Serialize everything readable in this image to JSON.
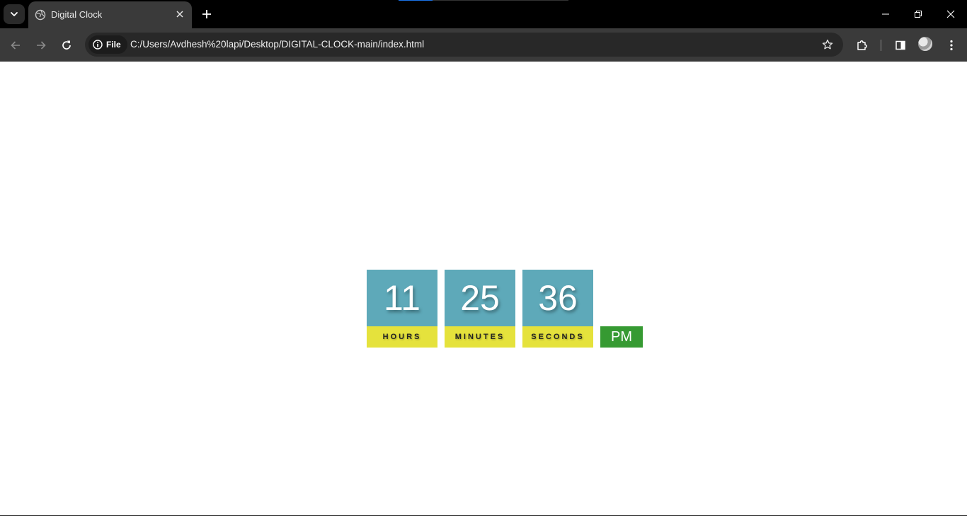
{
  "browser": {
    "tab": {
      "title": "Digital Clock"
    },
    "site_chip_label": "File",
    "url": "C:/Users/Avdhesh%20lapi/Desktop/DIGITAL-CLOCK-main/index.html"
  },
  "icons": {
    "tab_search": "chevron-down-icon",
    "favicon": "globe-icon",
    "tab_close": "close-icon",
    "new_tab": "plus-icon",
    "minimize": "minimize-icon",
    "restore": "restore-icon",
    "close": "close-icon",
    "back": "arrow-left-icon",
    "forward": "arrow-right-icon",
    "reload": "reload-icon",
    "info": "info-icon",
    "bookmark": "star-icon",
    "extensions": "puzzle-icon",
    "side_panel": "side-panel-icon",
    "profile": "avatar-icon",
    "menu": "kebab-menu-icon"
  },
  "clock": {
    "hours": "11",
    "hours_label": "HOURS",
    "minutes": "25",
    "minutes_label": "MINUTES",
    "seconds": "36",
    "seconds_label": "SECONDS",
    "period": "PM"
  },
  "colors": {
    "digit_bg": "#5ea9b9",
    "label_bg": "#e5e23c",
    "period_bg": "#369a32"
  }
}
